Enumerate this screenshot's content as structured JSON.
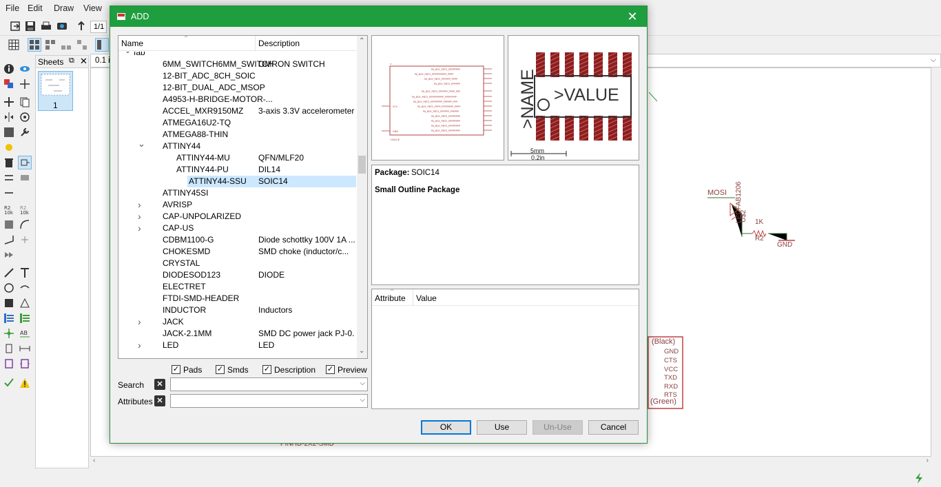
{
  "menu": {
    "file": "File",
    "edit": "Edit",
    "draw": "Draw",
    "view": "View"
  },
  "toolbar": {
    "sheet_counter": "1/1",
    "grid_value": "0.1 i"
  },
  "sheets": {
    "title": "Sheets",
    "sheet_number": "1"
  },
  "schematic": {
    "mosi_label": "MOSI",
    "led_part": "LEDFAB1206",
    "led_ref": "U$2",
    "resistor_value": "1K",
    "resistor_ref": "R2",
    "gnd_label": "GND",
    "ftdi_top": "(Black)",
    "ftdi_pins": [
      "GND",
      "CTS",
      "VCC",
      "TXD",
      "RXD",
      "RTS"
    ],
    "ftdi_bottom": "(Green)",
    "bottom_label": "PINHD-2X2-SMD"
  },
  "dialog": {
    "title": "ADD",
    "close_glyph": "✕",
    "tree": {
      "col_name": "Name",
      "col_desc": "Description",
      "rows": [
        {
          "name": "fab",
          "desc": "",
          "level": 0,
          "arrow": "expanded"
        },
        {
          "name": "6MM_SWITCH6MM_SWITCH",
          "desc": "OMRON SWITCH",
          "level": 1,
          "arrow": ""
        },
        {
          "name": "12-BIT_ADC_8CH_SOIC",
          "desc": "",
          "level": 1,
          "arrow": ""
        },
        {
          "name": "12-BIT_DUAL_ADC_MSOP",
          "desc": "",
          "level": 1,
          "arrow": ""
        },
        {
          "name": "A4953-H-BRIDGE-MOTOR-...",
          "desc": "",
          "level": 1,
          "arrow": ""
        },
        {
          "name": "ACCEL_MXR9150MZ",
          "desc": "3-axis 3.3V accelerometer",
          "level": 1,
          "arrow": ""
        },
        {
          "name": "ATMEGA16U2-TQ",
          "desc": "",
          "level": 1,
          "arrow": ""
        },
        {
          "name": "ATMEGA88-THIN",
          "desc": "",
          "level": 1,
          "arrow": ""
        },
        {
          "name": "ATTINY44",
          "desc": "",
          "level": 1,
          "arrow": "expanded"
        },
        {
          "name": "ATTINY44-MU",
          "desc": "QFN/MLF20",
          "level": 2,
          "arrow": ""
        },
        {
          "name": "ATTINY44-PU",
          "desc": "DIL14",
          "level": 2,
          "arrow": ""
        },
        {
          "name": "ATTINY44-SSU",
          "desc": "SOIC14",
          "level": 2,
          "arrow": "",
          "selected": true
        },
        {
          "name": "ATTINY45SI",
          "desc": "",
          "level": 1,
          "arrow": ""
        },
        {
          "name": "AVRISP",
          "desc": "",
          "level": 1,
          "arrow": "collapsed"
        },
        {
          "name": "CAP-UNPOLARIZED",
          "desc": "",
          "level": 1,
          "arrow": "collapsed"
        },
        {
          "name": "CAP-US",
          "desc": "",
          "level": 1,
          "arrow": "collapsed"
        },
        {
          "name": "CDBM1100-G",
          "desc": "Diode schottky 100V 1A ...",
          "level": 1,
          "arrow": ""
        },
        {
          "name": "CHOKESMD",
          "desc": "SMD choke (inductor/c...",
          "level": 1,
          "arrow": ""
        },
        {
          "name": "CRYSTAL",
          "desc": "",
          "level": 1,
          "arrow": ""
        },
        {
          "name": "DIODESOD123",
          "desc": "DIODE",
          "level": 1,
          "arrow": ""
        },
        {
          "name": "ELECTRET",
          "desc": "",
          "level": 1,
          "arrow": ""
        },
        {
          "name": "FTDI-SMD-HEADER",
          "desc": "",
          "level": 1,
          "arrow": ""
        },
        {
          "name": "INDUCTOR",
          "desc": "Inductors",
          "level": 1,
          "arrow": ""
        },
        {
          "name": "JACK",
          "desc": "",
          "level": 1,
          "arrow": "collapsed"
        },
        {
          "name": "JACK-2.1MM",
          "desc": "SMD DC power jack PJ-0...",
          "level": 1,
          "arrow": ""
        },
        {
          "name": "LED",
          "desc": "LED",
          "level": 1,
          "arrow": "collapsed"
        }
      ]
    },
    "filters": {
      "pads": "Pads",
      "smds": "Smds",
      "description": "Description",
      "preview": "Preview"
    },
    "search_label": "Search",
    "attributes_label": "Attributes",
    "search_value": "",
    "attributes_value": "",
    "package_preview": {
      "name_text": ">NAME",
      "value_text": ">VALUE",
      "scale_mm": "5mm",
      "scale_in": "0.2in"
    },
    "info": {
      "package_label": "Package:",
      "package_value": "SOIC14",
      "description": "Small Outline Package"
    },
    "attr_table": {
      "col_attribute": "Attribute",
      "col_value": "Value"
    },
    "buttons": {
      "ok": "OK",
      "use": "Use",
      "unuse": "Un-Use",
      "cancel": "Cancel"
    }
  }
}
